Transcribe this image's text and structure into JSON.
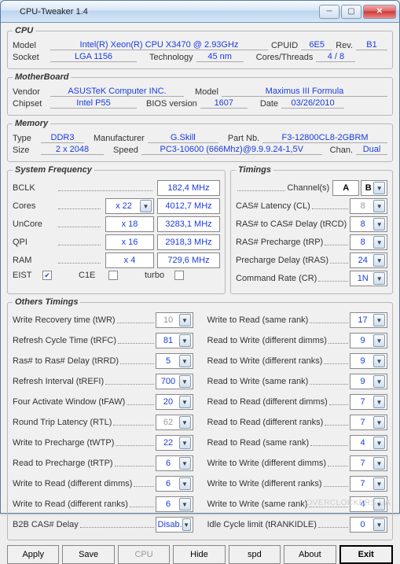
{
  "title": "CPU-Tweaker 1.4",
  "cpu": {
    "legend": "CPU",
    "modelL": "Model",
    "model": "Intel(R) Xeon(R) CPU        X3470  @ 2.93GHz",
    "cpuidL": "CPUID",
    "cpuid": "6E5",
    "revL": "Rev.",
    "rev": "B1",
    "socketL": "Socket",
    "socket": "LGA 1156",
    "techL": "Technology",
    "tech": "45 nm",
    "ctL": "Cores/Threads",
    "ct": "4 / 8"
  },
  "mb": {
    "legend": "MotherBoard",
    "vendorL": "Vendor",
    "vendor": "ASUSTeK Computer INC.",
    "modelL": "Model",
    "model": "Maximus III Formula",
    "chipsetL": "Chipset",
    "chipset": "Intel P55",
    "biosL": "BIOS version",
    "bios": "1607",
    "dateL": "Date",
    "date": "03/26/2010"
  },
  "mem": {
    "legend": "Memory",
    "typeL": "Type",
    "type": "DDR3",
    "mfrL": "Manufacturer",
    "mfr": "G.Skill",
    "pnL": "Part Nb.",
    "pn": "F3-12800CL8-2GBRM",
    "sizeL": "Size",
    "size": "2 x 2048",
    "speedL": "Speed",
    "speed": "PC3-10600 (666Mhz)@9.9.9.24-1,5V",
    "chanL": "Chan.",
    "chan": "Dual"
  },
  "sys": {
    "legend": "System Frequency",
    "bclkL": "BCLK",
    "bclk": "182,4 MHz",
    "coresL": "Cores",
    "coresM": "x 22",
    "cores": "4012,7 MHz",
    "uncoreL": "UnCore",
    "uncoreM": "x 18",
    "uncore": "3283,1 MHz",
    "qpiL": "QPI",
    "qpiM": "x 16",
    "qpi": "2918,3 MHz",
    "ramL": "RAM",
    "ramM": "x 4",
    "ram": "729,6 MHz",
    "eistL": "EIST",
    "c1eL": "C1E",
    "turboL": "turbo"
  },
  "tim": {
    "legend": "Timings",
    "chL": "Channel(s)",
    "chA": "A",
    "chB": "B",
    "r": [
      {
        "l": "CAS# Latency (CL)",
        "v": "8",
        "d": true
      },
      {
        "l": "RAS# to CAS# Delay (tRCD)",
        "v": "8"
      },
      {
        "l": "RAS# Precharge (tRP)",
        "v": "8"
      },
      {
        "l": "Precharge Delay (tRAS)",
        "v": "24"
      },
      {
        "l": "Command Rate (CR)",
        "v": "1N"
      }
    ]
  },
  "ot": {
    "legend": "Others Timings",
    "left": [
      {
        "l": "Write Recovery time (tWR)",
        "v": "10",
        "d": true
      },
      {
        "l": "Refresh Cycle Time (tRFC)",
        "v": "81"
      },
      {
        "l": "Ras# to Ras# Delay (tRRD)",
        "v": "5"
      },
      {
        "l": "Refresh Interval (tREFI)",
        "v": "700"
      },
      {
        "l": "Four Activate Window (tFAW)",
        "v": "20"
      },
      {
        "l": "Round Trip Latency (RTL)",
        "v": "62",
        "d": true
      },
      {
        "l": "Write to Precharge (tWTP)",
        "v": "22"
      },
      {
        "l": "Read to Precharge (tRTP)",
        "v": "6"
      },
      {
        "l": "Write to Read (different dimms)",
        "v": "6"
      },
      {
        "l": "Write to Read (different ranks)",
        "v": "6"
      },
      {
        "l": "B2B CAS# Delay",
        "v": "Disab."
      }
    ],
    "right": [
      {
        "l": "Write to Read (same rank)",
        "v": "17"
      },
      {
        "l": "Read to Write (different dimms)",
        "v": "9"
      },
      {
        "l": "Read to Write (different ranks)",
        "v": "9"
      },
      {
        "l": "Read to Write (same rank)",
        "v": "9"
      },
      {
        "l": "Read to Read (different dimms)",
        "v": "7"
      },
      {
        "l": "Read to Read (different ranks)",
        "v": "7"
      },
      {
        "l": "Read to Read (same rank)",
        "v": "4"
      },
      {
        "l": "Write to Write (different dimms)",
        "v": "7"
      },
      {
        "l": "Write to Write (different ranks)",
        "v": "7"
      },
      {
        "l": "Write to Write (same rank)",
        "v": "4"
      },
      {
        "l": "Idle Cycle limit (tRANKIDLE)",
        "v": "0"
      }
    ]
  },
  "btns": {
    "apply": "Apply",
    "save": "Save",
    "cpu": "CPU",
    "hide": "Hide",
    "spd": "spd",
    "about": "About",
    "exit": "Exit"
  },
  "wm": "OVERCLOCKERS.UA"
}
